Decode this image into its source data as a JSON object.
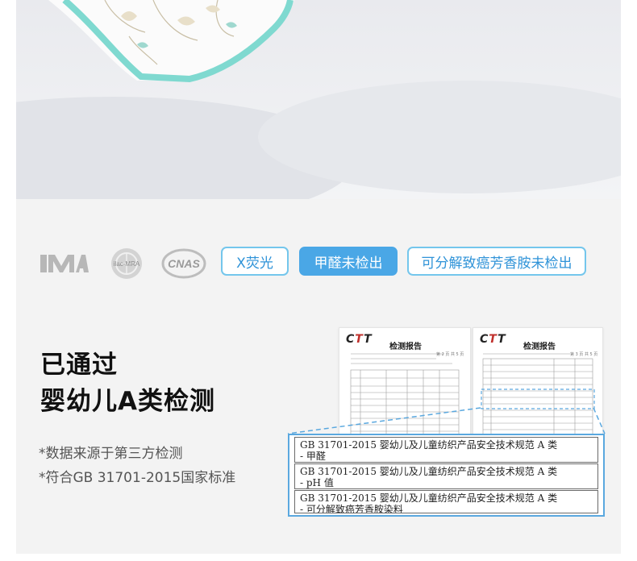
{
  "certifications": [
    {
      "name": "cma-logo",
      "label": "CMA"
    },
    {
      "name": "ilac-mra-logo",
      "label": "ilac-MRA"
    },
    {
      "name": "cnas-logo",
      "label": "CNAS"
    }
  ],
  "tags": [
    {
      "label": "X荧光",
      "style": "outline"
    },
    {
      "label": "甲醛未检出",
      "style": "filled"
    },
    {
      "label": "可分解致癌芳香胺未检出",
      "style": "outline"
    }
  ],
  "headline": {
    "line1": "已通过",
    "line2": "婴幼儿A类检测"
  },
  "notes": {
    "source": "*数据来源于第三方检测",
    "standard": "*符合GB 31701-2015国家标准"
  },
  "reports": [
    {
      "brand_prefix": "C",
      "brand_mid": "T",
      "brand_suffix": "T",
      "title": "检测报告"
    },
    {
      "brand_prefix": "C",
      "brand_mid": "T",
      "brand_suffix": "T",
      "title": "检测报告"
    }
  ],
  "zoom_rows": [
    {
      "line1": "GB 31701-2015  婴幼儿及儿童纺织产品安全技术规范  A 类",
      "line2": "-  甲醛"
    },
    {
      "line1": "GB 31701-2015  婴幼儿及儿童纺织产品安全技术规范  A 类",
      "line2": "- pH 值"
    },
    {
      "line1": "GB 31701-2015  婴幼儿及儿童纺织产品安全技术规范  A 类",
      "line2": "-  可分解致癌芳香胺染料"
    }
  ],
  "colors": {
    "accent": "#4aa7e6",
    "outline": "#74c6ec",
    "tag_text": "#2f93d8",
    "panel_bg": "#f3f3f3",
    "trim": "#7fd9d0"
  }
}
